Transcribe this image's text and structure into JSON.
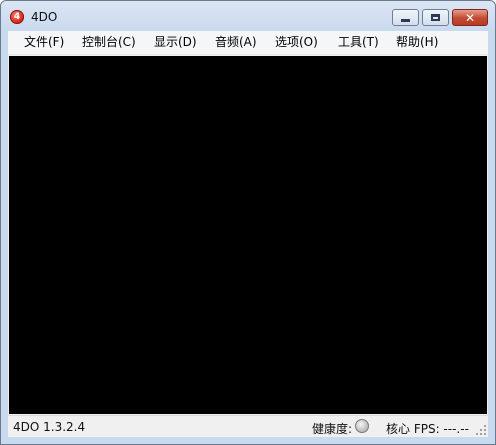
{
  "window": {
    "title": "4DO",
    "icon_glyph": "4",
    "controls": {
      "minimize": "minimize-icon",
      "maximize": "maximize-icon",
      "close": "close-icon"
    }
  },
  "menu": [
    {
      "label": "文件(F)"
    },
    {
      "label": "控制台(C)"
    },
    {
      "label": "显示(D)"
    },
    {
      "label": "音频(A)"
    },
    {
      "label": "选项(O)"
    },
    {
      "label": "工具(T)"
    },
    {
      "label": "帮助(H)"
    }
  ],
  "status": {
    "version": "4DO 1.3.2.4",
    "health_label": "健康度:",
    "fps_label": "核心 FPS: ---.--"
  },
  "colors": {
    "screen": "#000000",
    "close_button": "#c34a33",
    "frame": "#c9d9ee"
  }
}
